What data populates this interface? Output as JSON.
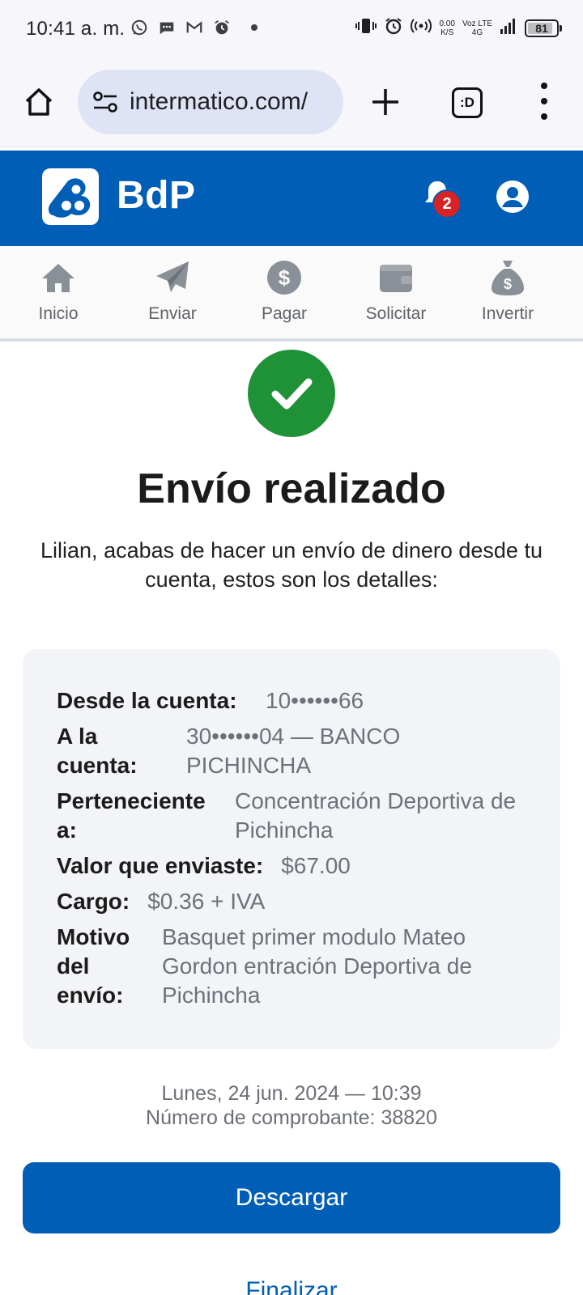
{
  "status_bar": {
    "time": "10:41 a. m.",
    "left_icons": [
      "whatsapp-icon",
      "message-icon",
      "gmail-icon",
      "alarm-icon"
    ],
    "net_speed_top": "0.00",
    "net_speed_bottom": "K/S",
    "volte_top": "Voz LTE",
    "volte_bottom": "4G",
    "battery": "81"
  },
  "browser": {
    "url": "intermatico.com/",
    "tabs_label": ":D"
  },
  "header": {
    "logo_text": "BdP",
    "notification_count": "2",
    "brand_color": "#015eb7"
  },
  "nav": {
    "items": [
      {
        "label": "Inicio",
        "icon": "home-icon"
      },
      {
        "label": "Enviar",
        "icon": "send-icon"
      },
      {
        "label": "Pagar",
        "icon": "dollar-icon"
      },
      {
        "label": "Solicitar",
        "icon": "wallet-icon"
      },
      {
        "label": "Invertir",
        "icon": "money-bag-icon"
      }
    ]
  },
  "result": {
    "status_color": "#1f9136",
    "title": "Envío realizado",
    "intro_line1": "Lilian, acabas de hacer un envío de dinero desde tu",
    "intro_line2": "cuenta, estos son los detalles:"
  },
  "details": {
    "from_label": "Desde la cuenta:",
    "from_value": "10••••••66",
    "to_label": "A la cuenta:",
    "to_value": "30••••••04 — BANCO PICHINCHA",
    "owner_label": "Perteneciente a:",
    "owner_value": "Concentración Deportiva de Pichincha",
    "amount_label": "Valor que enviaste:",
    "amount_value": "$67.00",
    "fee_label": "Cargo:",
    "fee_value": "$0.36 + IVA",
    "reason_label": "Motivo del envío:",
    "reason_value": "Basquet primer modulo Mateo Gordon entración Deportiva de Pichincha"
  },
  "meta": {
    "datetime": "Lunes, 24 jun. 2024 — 10:39",
    "receipt": "Número de comprobante: 38820"
  },
  "actions": {
    "download": "Descargar",
    "finish": "Finalizar"
  }
}
